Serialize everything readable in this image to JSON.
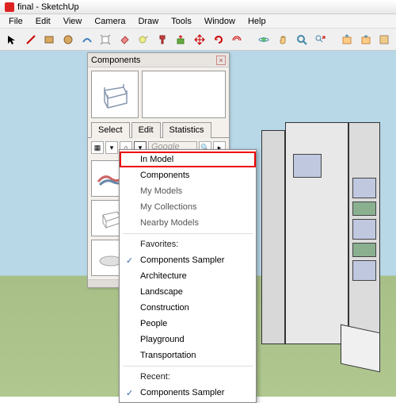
{
  "title": "final - SketchUp",
  "menu": {
    "file": "File",
    "edit": "Edit",
    "view": "View",
    "camera": "Camera",
    "draw": "Draw",
    "tools": "Tools",
    "window": "Window",
    "help": "Help"
  },
  "panel": {
    "title": "Components",
    "tabs": {
      "select": "Select",
      "edit": "Edit",
      "stats": "Statistics"
    },
    "search_placeholder": "Google"
  },
  "dropdown": {
    "in_model": "In Model",
    "components": "Components",
    "my_models": "My Models",
    "my_collections": "My Collections",
    "nearby": "Nearby Models",
    "fav_hdr": "Favorites:",
    "fav": [
      "Components Sampler",
      "Architecture",
      "Landscape",
      "Construction",
      "People",
      "Playground",
      "Transportation"
    ],
    "recent_hdr": "Recent:",
    "recent": [
      "Components Sampler"
    ]
  }
}
